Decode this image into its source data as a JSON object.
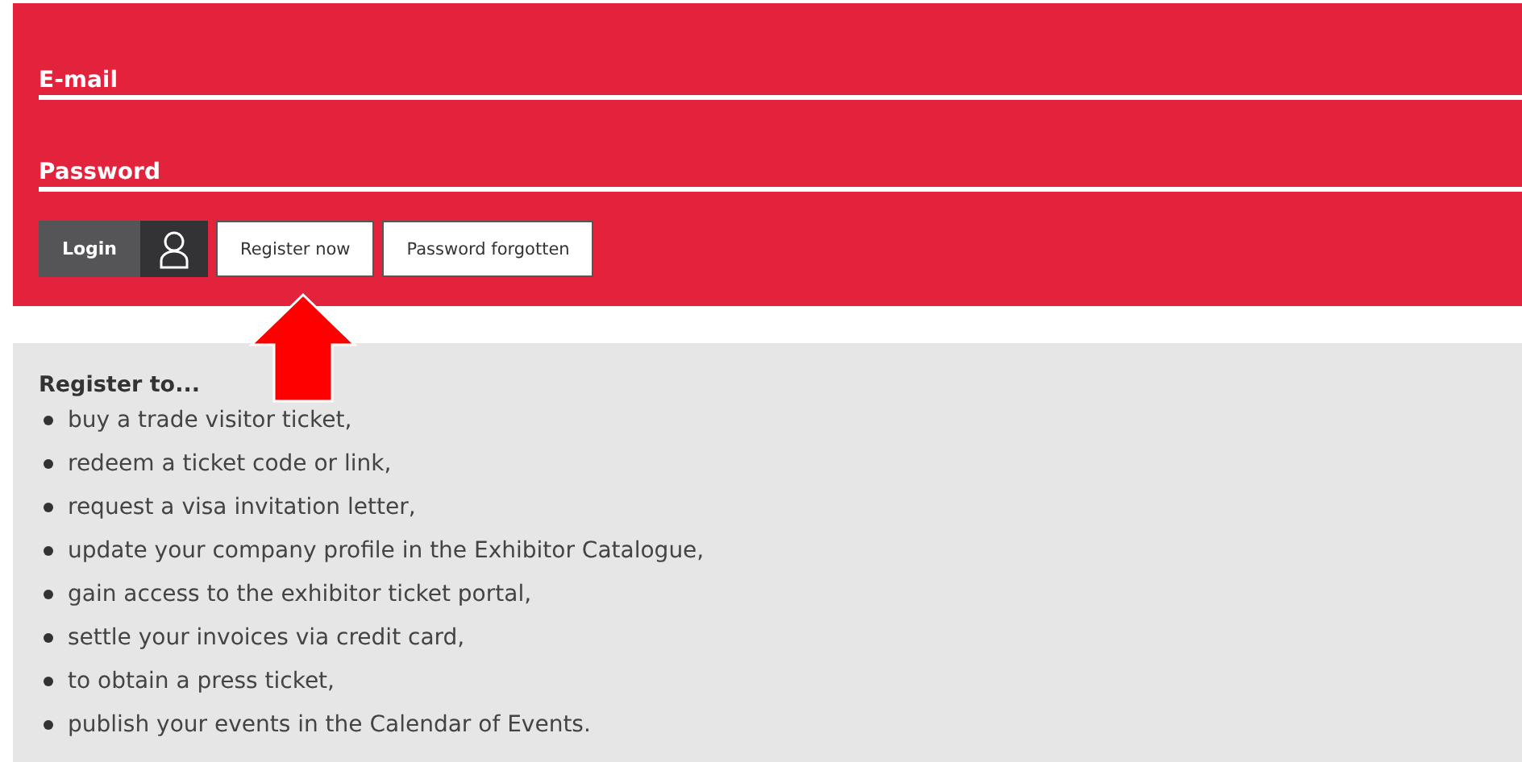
{
  "login_form": {
    "fields": [
      {
        "label": "E-mail"
      },
      {
        "label": "Password"
      }
    ],
    "login_button": {
      "label": "Login"
    },
    "buttons": [
      {
        "label": "Register now"
      },
      {
        "label": "Password forgotten"
      }
    ]
  },
  "register_info": {
    "heading": "Register to...",
    "items": [
      "buy a trade visitor ticket,",
      "redeem a ticket code or link,",
      "request a visa invitation letter,",
      "update your company profile in the Exhibitor Catalogue,",
      "gain access to the exhibitor ticket portal,",
      "settle your invoices via credit card,",
      "to obtain a press ticket,",
      "publish your events in the Calendar of Events."
    ]
  }
}
